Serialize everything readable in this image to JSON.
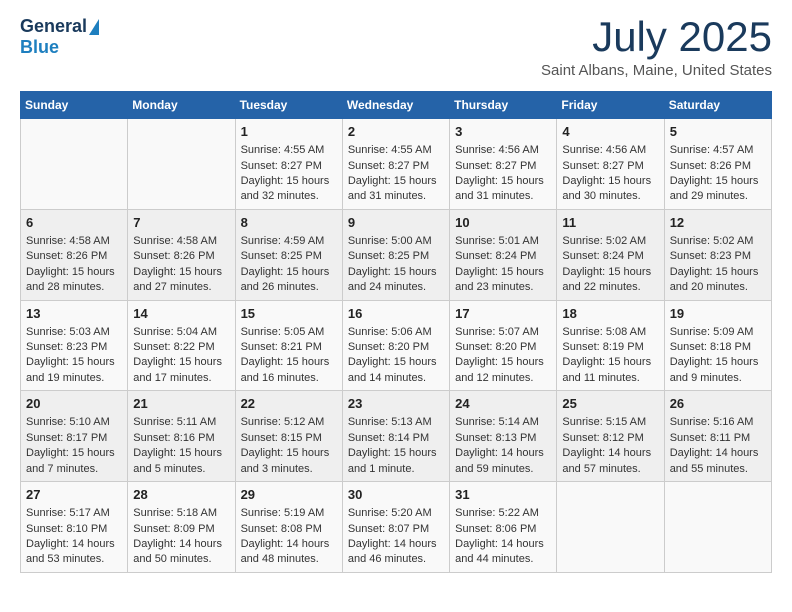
{
  "logo": {
    "general": "General",
    "blue": "Blue"
  },
  "title": "July 2025",
  "subtitle": "Saint Albans, Maine, United States",
  "days_of_week": [
    "Sunday",
    "Monday",
    "Tuesday",
    "Wednesday",
    "Thursday",
    "Friday",
    "Saturday"
  ],
  "weeks": [
    [
      {
        "day": "",
        "info": ""
      },
      {
        "day": "",
        "info": ""
      },
      {
        "day": "1",
        "info": "Sunrise: 4:55 AM\nSunset: 8:27 PM\nDaylight: 15 hours and 32 minutes."
      },
      {
        "day": "2",
        "info": "Sunrise: 4:55 AM\nSunset: 8:27 PM\nDaylight: 15 hours and 31 minutes."
      },
      {
        "day": "3",
        "info": "Sunrise: 4:56 AM\nSunset: 8:27 PM\nDaylight: 15 hours and 31 minutes."
      },
      {
        "day": "4",
        "info": "Sunrise: 4:56 AM\nSunset: 8:27 PM\nDaylight: 15 hours and 30 minutes."
      },
      {
        "day": "5",
        "info": "Sunrise: 4:57 AM\nSunset: 8:26 PM\nDaylight: 15 hours and 29 minutes."
      }
    ],
    [
      {
        "day": "6",
        "info": "Sunrise: 4:58 AM\nSunset: 8:26 PM\nDaylight: 15 hours and 28 minutes."
      },
      {
        "day": "7",
        "info": "Sunrise: 4:58 AM\nSunset: 8:26 PM\nDaylight: 15 hours and 27 minutes."
      },
      {
        "day": "8",
        "info": "Sunrise: 4:59 AM\nSunset: 8:25 PM\nDaylight: 15 hours and 26 minutes."
      },
      {
        "day": "9",
        "info": "Sunrise: 5:00 AM\nSunset: 8:25 PM\nDaylight: 15 hours and 24 minutes."
      },
      {
        "day": "10",
        "info": "Sunrise: 5:01 AM\nSunset: 8:24 PM\nDaylight: 15 hours and 23 minutes."
      },
      {
        "day": "11",
        "info": "Sunrise: 5:02 AM\nSunset: 8:24 PM\nDaylight: 15 hours and 22 minutes."
      },
      {
        "day": "12",
        "info": "Sunrise: 5:02 AM\nSunset: 8:23 PM\nDaylight: 15 hours and 20 minutes."
      }
    ],
    [
      {
        "day": "13",
        "info": "Sunrise: 5:03 AM\nSunset: 8:23 PM\nDaylight: 15 hours and 19 minutes."
      },
      {
        "day": "14",
        "info": "Sunrise: 5:04 AM\nSunset: 8:22 PM\nDaylight: 15 hours and 17 minutes."
      },
      {
        "day": "15",
        "info": "Sunrise: 5:05 AM\nSunset: 8:21 PM\nDaylight: 15 hours and 16 minutes."
      },
      {
        "day": "16",
        "info": "Sunrise: 5:06 AM\nSunset: 8:20 PM\nDaylight: 15 hours and 14 minutes."
      },
      {
        "day": "17",
        "info": "Sunrise: 5:07 AM\nSunset: 8:20 PM\nDaylight: 15 hours and 12 minutes."
      },
      {
        "day": "18",
        "info": "Sunrise: 5:08 AM\nSunset: 8:19 PM\nDaylight: 15 hours and 11 minutes."
      },
      {
        "day": "19",
        "info": "Sunrise: 5:09 AM\nSunset: 8:18 PM\nDaylight: 15 hours and 9 minutes."
      }
    ],
    [
      {
        "day": "20",
        "info": "Sunrise: 5:10 AM\nSunset: 8:17 PM\nDaylight: 15 hours and 7 minutes."
      },
      {
        "day": "21",
        "info": "Sunrise: 5:11 AM\nSunset: 8:16 PM\nDaylight: 15 hours and 5 minutes."
      },
      {
        "day": "22",
        "info": "Sunrise: 5:12 AM\nSunset: 8:15 PM\nDaylight: 15 hours and 3 minutes."
      },
      {
        "day": "23",
        "info": "Sunrise: 5:13 AM\nSunset: 8:14 PM\nDaylight: 15 hours and 1 minute."
      },
      {
        "day": "24",
        "info": "Sunrise: 5:14 AM\nSunset: 8:13 PM\nDaylight: 14 hours and 59 minutes."
      },
      {
        "day": "25",
        "info": "Sunrise: 5:15 AM\nSunset: 8:12 PM\nDaylight: 14 hours and 57 minutes."
      },
      {
        "day": "26",
        "info": "Sunrise: 5:16 AM\nSunset: 8:11 PM\nDaylight: 14 hours and 55 minutes."
      }
    ],
    [
      {
        "day": "27",
        "info": "Sunrise: 5:17 AM\nSunset: 8:10 PM\nDaylight: 14 hours and 53 minutes."
      },
      {
        "day": "28",
        "info": "Sunrise: 5:18 AM\nSunset: 8:09 PM\nDaylight: 14 hours and 50 minutes."
      },
      {
        "day": "29",
        "info": "Sunrise: 5:19 AM\nSunset: 8:08 PM\nDaylight: 14 hours and 48 minutes."
      },
      {
        "day": "30",
        "info": "Sunrise: 5:20 AM\nSunset: 8:07 PM\nDaylight: 14 hours and 46 minutes."
      },
      {
        "day": "31",
        "info": "Sunrise: 5:22 AM\nSunset: 8:06 PM\nDaylight: 14 hours and 44 minutes."
      },
      {
        "day": "",
        "info": ""
      },
      {
        "day": "",
        "info": ""
      }
    ]
  ]
}
